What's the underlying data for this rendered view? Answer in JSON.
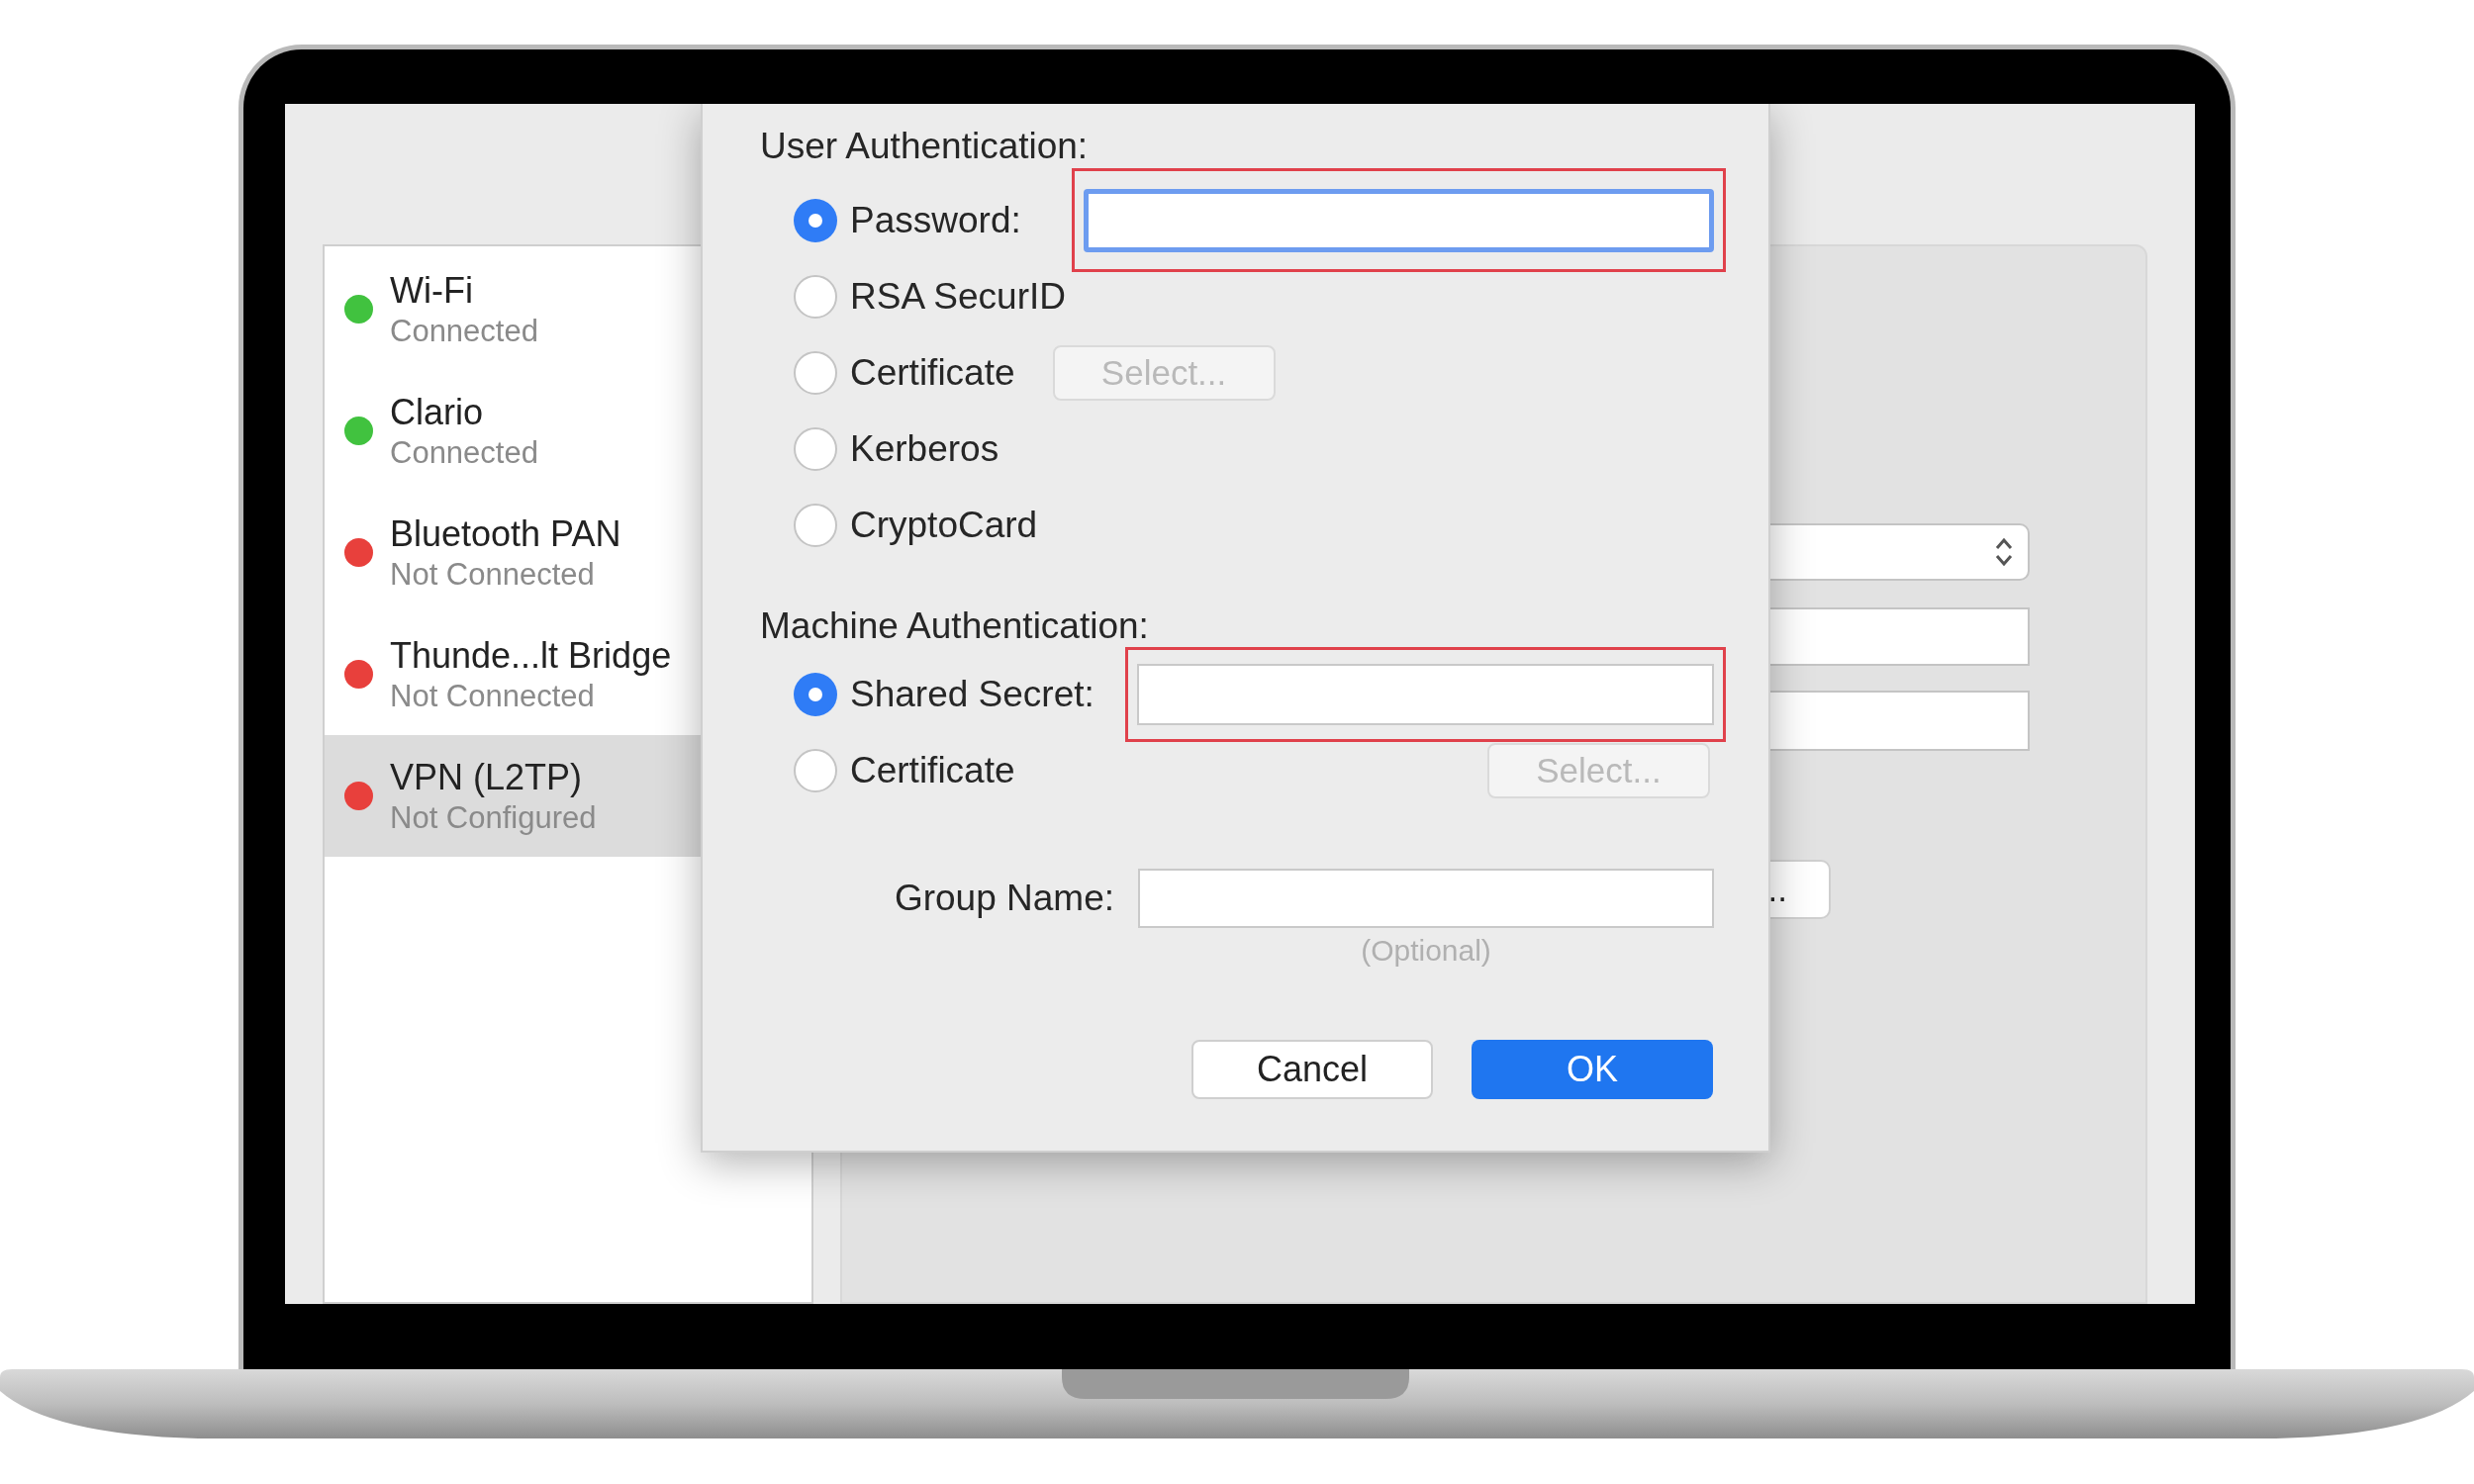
{
  "sidebar": {
    "items": [
      {
        "name": "Wi-Fi",
        "status": "Connected",
        "color": "#41c23f",
        "selected": false
      },
      {
        "name": "Clario",
        "status": "Connected",
        "color": "#41c23f",
        "selected": false
      },
      {
        "name": "Bluetooth PAN",
        "status": "Not Connected",
        "color": "#e8403c",
        "selected": false
      },
      {
        "name": "Thunde...lt Bridge",
        "status": "Not Connected",
        "color": "#e8403c",
        "selected": false
      },
      {
        "name": "VPN (L2TP)",
        "status": "Not Configured",
        "color": "#e8403c",
        "selected": true
      }
    ]
  },
  "background_panel": {
    "button_label": ".."
  },
  "dialog": {
    "sections": [
      {
        "title": "User Authentication:",
        "options": [
          {
            "label": "Password:",
            "kind": "field",
            "selected": true,
            "highlighted": true,
            "focused": true
          },
          {
            "label": "RSA SecurID",
            "kind": "plain",
            "selected": false
          },
          {
            "label": "Certificate",
            "kind": "select",
            "selected": false,
            "button": {
              "label": "Select...",
              "disabled": true
            }
          },
          {
            "label": "Kerberos",
            "kind": "plain",
            "selected": false
          },
          {
            "label": "CryptoCard",
            "kind": "plain",
            "selected": false
          }
        ]
      },
      {
        "title": "Machine Authentication:",
        "options": [
          {
            "label": "Shared Secret:",
            "kind": "field",
            "selected": true,
            "highlighted": true,
            "focused": false
          },
          {
            "label": "Certificate",
            "kind": "select",
            "selected": false,
            "button": {
              "label": "Select...",
              "disabled": true
            }
          }
        ]
      }
    ],
    "group": {
      "label": "Group Name:",
      "hint": "(Optional)"
    },
    "buttons": [
      {
        "label": "Cancel",
        "default": false
      },
      {
        "label": "OK",
        "default": true
      }
    ]
  }
}
